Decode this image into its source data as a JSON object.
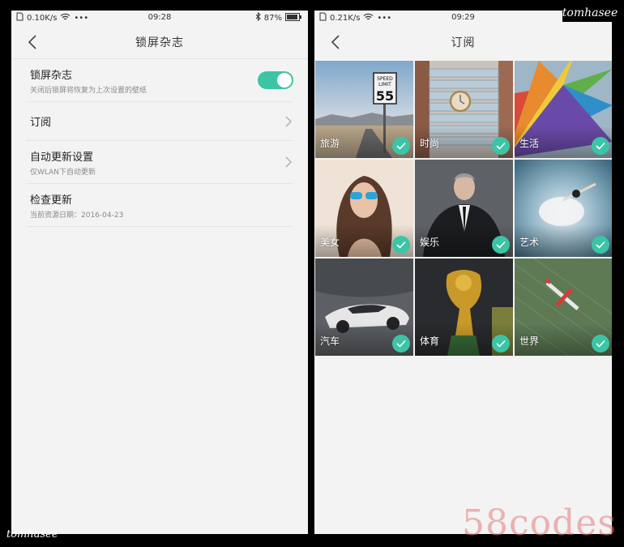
{
  "left": {
    "status": {
      "speed": "0.10K/s",
      "time": "09:28",
      "battery": "87%"
    },
    "title": "锁屏杂志",
    "rows": [
      {
        "main": "锁屏杂志",
        "sub": "关闭后锁屏将恢复为上次设置的壁纸"
      },
      {
        "main": "订阅",
        "sub": ""
      },
      {
        "main": "自动更新设置",
        "sub": "仅WLAN下自动更新"
      },
      {
        "main": "检查更新",
        "sub": "当前资源日期：2016-04-23"
      }
    ]
  },
  "right": {
    "status": {
      "speed": "0.21K/s",
      "time": "09:29"
    },
    "title": "订阅",
    "tiles": [
      {
        "label": "旅游",
        "sign_line1": "SPEED",
        "sign_line2": "LIMIT",
        "sign_num": "55"
      },
      {
        "label": "时尚"
      },
      {
        "label": "生活"
      },
      {
        "label": "美女"
      },
      {
        "label": "娱乐"
      },
      {
        "label": "艺术"
      },
      {
        "label": "汽车"
      },
      {
        "label": "体育"
      },
      {
        "label": "世界"
      }
    ]
  },
  "watermarks": {
    "top": "tomhasee",
    "bottom": "tomhasee",
    "brand": "58codes"
  },
  "colors": {
    "accent": "#3cc4a6",
    "background": "#f3f3f3"
  }
}
